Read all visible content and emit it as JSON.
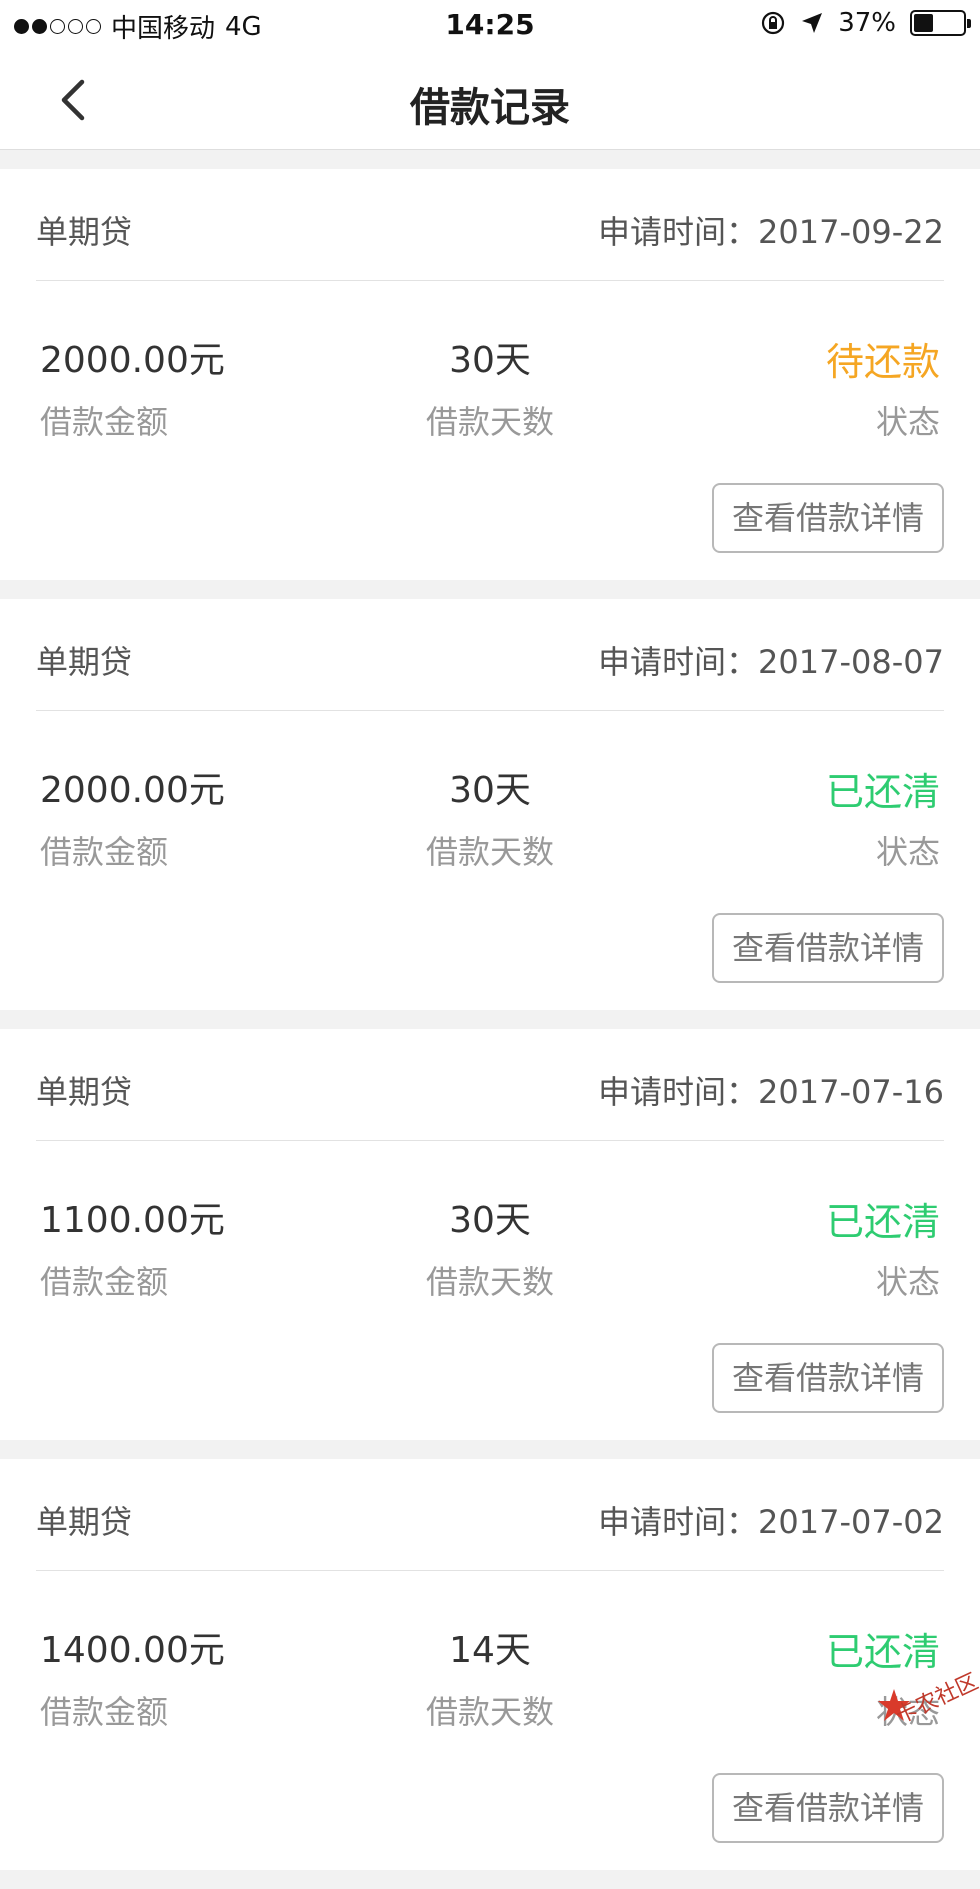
{
  "status_bar": {
    "carrier": "中国移动",
    "network": "4G",
    "time": "14:25",
    "battery_text": "37%",
    "battery_level": 0.37,
    "signal_bars": 2,
    "signal_total": 5
  },
  "nav": {
    "title": "借款记录",
    "back_icon": "chevron-left-icon"
  },
  "colors": {
    "pending": "#f5a623",
    "repaid": "#2ecc71"
  },
  "records": [
    {
      "product": "单期贷",
      "apply_label": "申请时间：",
      "apply_date": "2017-09-22",
      "amount": "2000.00元",
      "amount_label": "借款金额",
      "days": "30天",
      "days_label": "借款天数",
      "status": "待还款",
      "status_type": "pending",
      "status_label": "状态",
      "detail_button": "查看借款详情"
    },
    {
      "product": "单期贷",
      "apply_label": "申请时间：",
      "apply_date": "2017-08-07",
      "amount": "2000.00元",
      "amount_label": "借款金额",
      "days": "30天",
      "days_label": "借款天数",
      "status": "已还清",
      "status_type": "repaid",
      "status_label": "状态",
      "detail_button": "查看借款详情"
    },
    {
      "product": "单期贷",
      "apply_label": "申请时间：",
      "apply_date": "2017-07-16",
      "amount": "1100.00元",
      "amount_label": "借款金额",
      "days": "30天",
      "days_label": "借款天数",
      "status": "已还清",
      "status_type": "repaid",
      "status_label": "状态",
      "detail_button": "查看借款详情"
    },
    {
      "product": "单期贷",
      "apply_label": "申请时间：",
      "apply_date": "2017-07-02",
      "amount": "1400.00元",
      "amount_label": "借款金额",
      "days": "14天",
      "days_label": "借款天数",
      "status": "已还清",
      "status_type": "repaid",
      "status_label": "状态",
      "detail_button": "查看借款详情"
    }
  ],
  "watermark": "卡农社区"
}
